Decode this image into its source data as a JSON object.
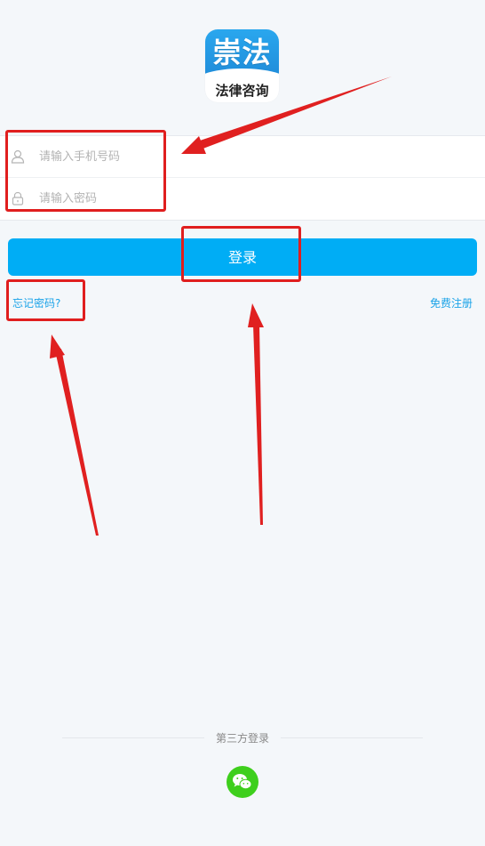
{
  "logo": {
    "title": "崇法",
    "subtitle": "法律咨询"
  },
  "form": {
    "phone": {
      "placeholder": "请输入手机号码",
      "icon": "user-icon"
    },
    "password": {
      "placeholder": "请输入密码",
      "icon": "lock-icon"
    }
  },
  "actions": {
    "login_label": "登录",
    "forgot_label": "忘记密码?",
    "register_label": "免费注册"
  },
  "third_party": {
    "label": "第三方登录",
    "providers": [
      {
        "icon": "wechat-icon"
      }
    ]
  },
  "colors": {
    "background": "#f4f7fa",
    "primary": "#00adf5",
    "link": "#1aa3e8",
    "wechat": "#3ecf1d",
    "annotation": "#e01e1e"
  }
}
